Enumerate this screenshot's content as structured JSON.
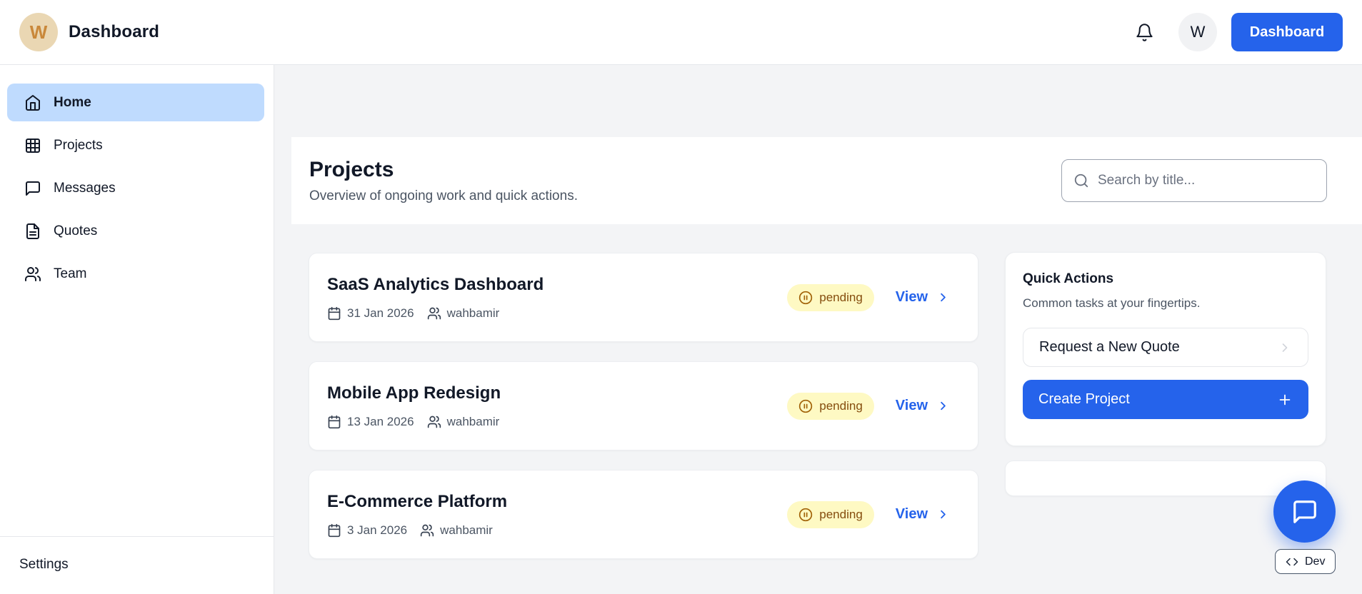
{
  "header": {
    "logo_letter": "W",
    "app_title": "Dashboard",
    "avatar_initial": "W",
    "nav_button_label": "Dashboard"
  },
  "sidebar": {
    "items": [
      {
        "label": "Home",
        "icon": "home-icon",
        "active": true
      },
      {
        "label": "Projects",
        "icon": "grid-icon",
        "active": false
      },
      {
        "label": "Messages",
        "icon": "message-icon",
        "active": false
      },
      {
        "label": "Quotes",
        "icon": "file-icon",
        "active": false
      },
      {
        "label": "Team",
        "icon": "users-icon",
        "active": false
      }
    ],
    "footer_label": "Settings"
  },
  "main": {
    "title": "Projects",
    "subtitle": "Overview of ongoing work and quick actions.",
    "search_placeholder": "Search by title...",
    "projects": [
      {
        "title": "SaaS Analytics Dashboard",
        "date": "31 Jan 2026",
        "owner": "wahbamir",
        "status": "pending",
        "action": "View"
      },
      {
        "title": "Mobile App Redesign",
        "date": "13 Jan 2026",
        "owner": "wahbamir",
        "status": "pending",
        "action": "View"
      },
      {
        "title": "E-Commerce Platform",
        "date": "3 Jan 2026",
        "owner": "wahbamir",
        "status": "pending",
        "action": "View"
      }
    ],
    "quick_actions": {
      "title": "Quick Actions",
      "subtitle": "Common tasks at your fingertips.",
      "buttons": [
        {
          "label": "Request a New Quote",
          "style": "secondary"
        },
        {
          "label": "Create Project",
          "style": "primary"
        }
      ]
    },
    "dev_badge_label": "Dev"
  },
  "colors": {
    "primary_blue": "#2563eb",
    "active_item_bg": "#bfdbfe",
    "status_badge_bg": "#fef9c3",
    "status_badge_text": "#854d0e",
    "logo_bg": "#ead7b3",
    "logo_letter": "#c9883a",
    "page_bg": "#f3f4f6"
  }
}
